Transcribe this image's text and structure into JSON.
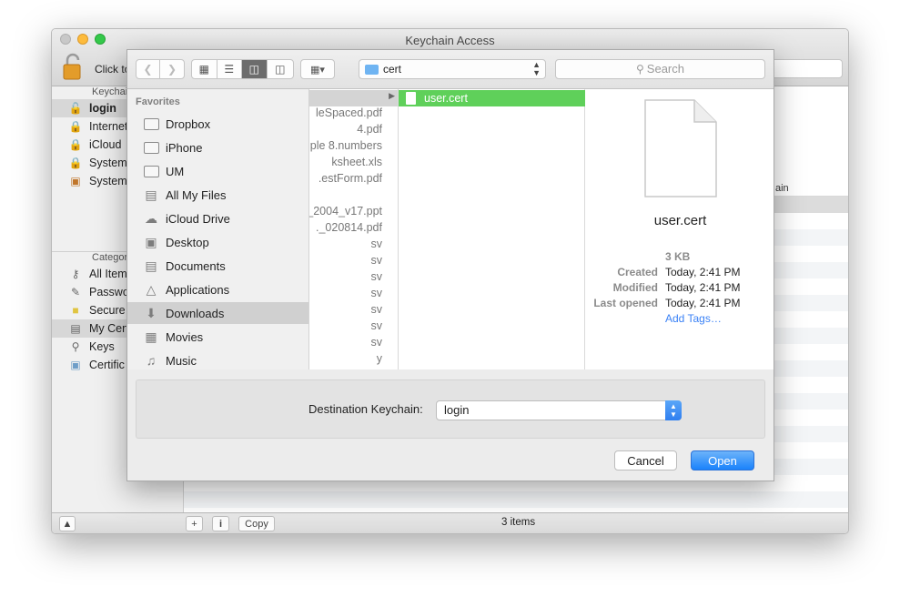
{
  "background_window": {
    "title": "Keychain Access",
    "lock_label": "Click to",
    "keychains_header": "Keychains",
    "keychains": [
      {
        "label": "login",
        "icon": "lock-open-icon"
      },
      {
        "label": "Internet",
        "icon": "lock-icon"
      },
      {
        "label": "iCloud",
        "icon": "lock-icon"
      },
      {
        "label": "System",
        "icon": "lock-icon"
      },
      {
        "label": "System",
        "icon": "certificate-icon"
      }
    ],
    "category_header": "Category",
    "categories": [
      {
        "label": "All Items",
        "icon": "keys-icon"
      },
      {
        "label": "Passwords",
        "icon": "pen-icon"
      },
      {
        "label": "Secure",
        "icon": "note-icon"
      },
      {
        "label": "My Cert",
        "icon": "my-certificate-icon"
      },
      {
        "label": "Keys",
        "icon": "key-icon"
      },
      {
        "label": "Certific",
        "icon": "certificate-icon"
      }
    ],
    "column_header": "ain",
    "bottom": {
      "copy_label": "Copy",
      "info_label": "i",
      "add_label": "+",
      "status": "3 items"
    }
  },
  "sheet": {
    "path_folder": "cert",
    "search_placeholder": "Search",
    "favorites_header": "Favorites",
    "favorites": [
      {
        "label": "Dropbox",
        "icon": "folder-icon"
      },
      {
        "label": "iPhone",
        "icon": "folder-icon"
      },
      {
        "label": "UM",
        "icon": "folder-icon"
      },
      {
        "label": "All My Files",
        "icon": "all-files-icon"
      },
      {
        "label": "iCloud Drive",
        "icon": "cloud-icon"
      },
      {
        "label": "Desktop",
        "icon": "desktop-icon"
      },
      {
        "label": "Documents",
        "icon": "documents-icon"
      },
      {
        "label": "Applications",
        "icon": "applications-icon"
      },
      {
        "label": "Downloads",
        "icon": "download-icon"
      },
      {
        "label": "Movies",
        "icon": "film-icon"
      },
      {
        "label": "Music",
        "icon": "music-icon"
      }
    ],
    "column1_files": [
      "",
      "leSpaced.pdf",
      "4.pdf",
      "ple 8.numbers",
      "ksheet.xls",
      ".estForm.pdf",
      "",
      "_2004_v17.ppt",
      "._020814.pdf",
      "sv",
      "sv",
      "sv",
      "sv",
      "sv",
      "sv",
      "sv",
      "y"
    ],
    "selected_file": "user.cert",
    "preview": {
      "name": "user.cert",
      "size": "3 KB",
      "created_label": "Created",
      "created": "Today, 2:41 PM",
      "modified_label": "Modified",
      "modified": "Today, 2:41 PM",
      "last_opened_label": "Last opened",
      "last_opened": "Today, 2:41 PM",
      "add_tags": "Add Tags…"
    },
    "destination_label": "Destination Keychain:",
    "destination_value": "login",
    "cancel_label": "Cancel",
    "open_label": "Open",
    "accent_color": "#1a82fb",
    "selection_color": "#5fd05a"
  }
}
